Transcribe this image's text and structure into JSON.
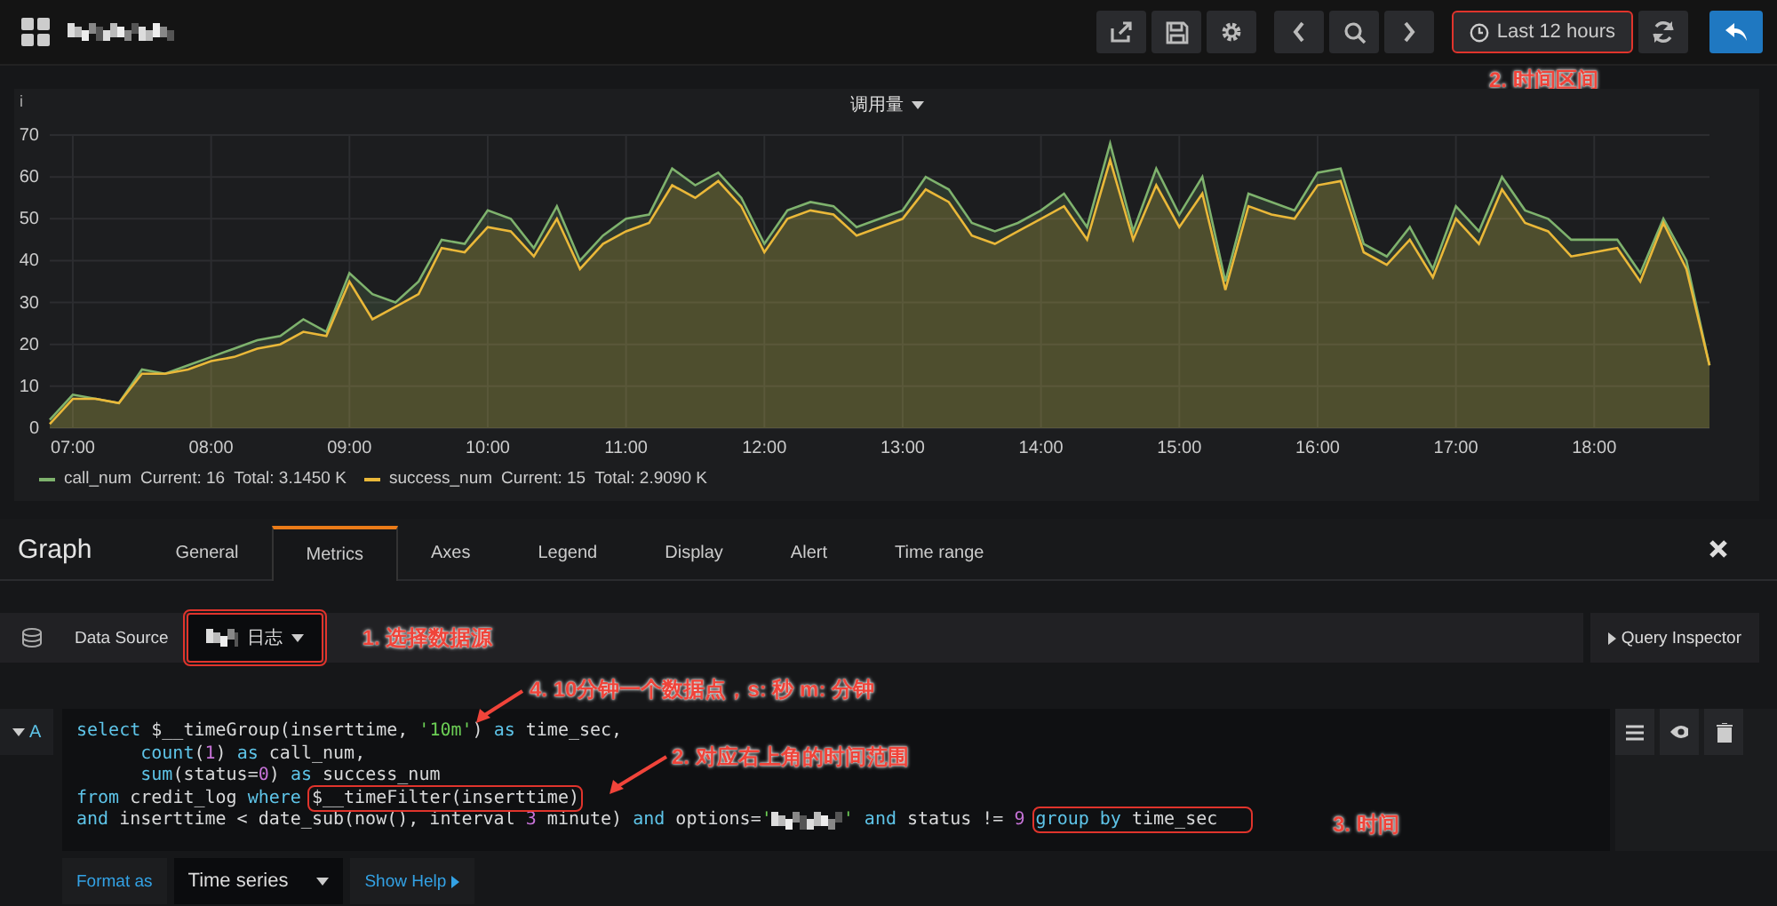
{
  "top_bar": {
    "time_picker": {
      "label": "Last 12 hours",
      "highlighted": true
    },
    "annotation": "2. 时间区间"
  },
  "panel": {
    "title": "调用量",
    "info": "i",
    "chart_data": {
      "type": "area",
      "grid": true,
      "ylim": [
        0,
        70
      ],
      "xlim": [
        410,
        1130
      ],
      "yticks": [
        0,
        10,
        20,
        30,
        40,
        50,
        60,
        70
      ],
      "xticks": [
        {
          "value": 420,
          "label": "07:00"
        },
        {
          "value": 480,
          "label": "08:00"
        },
        {
          "value": 540,
          "label": "09:00"
        },
        {
          "value": 600,
          "label": "10:00"
        },
        {
          "value": 660,
          "label": "11:00"
        },
        {
          "value": 720,
          "label": "12:00"
        },
        {
          "value": 780,
          "label": "13:00"
        },
        {
          "value": 840,
          "label": "14:00"
        },
        {
          "value": 900,
          "label": "15:00"
        },
        {
          "value": 960,
          "label": "16:00"
        },
        {
          "value": 1020,
          "label": "17:00"
        },
        {
          "value": 1080,
          "label": "18:00"
        }
      ],
      "x": [
        410,
        420,
        430,
        440,
        450,
        460,
        470,
        480,
        490,
        500,
        510,
        520,
        530,
        540,
        550,
        560,
        570,
        580,
        590,
        600,
        610,
        620,
        630,
        640,
        650,
        660,
        670,
        680,
        690,
        700,
        710,
        720,
        730,
        740,
        750,
        760,
        770,
        780,
        790,
        800,
        810,
        820,
        830,
        840,
        850,
        860,
        870,
        880,
        890,
        900,
        910,
        920,
        930,
        940,
        950,
        960,
        970,
        980,
        990,
        1000,
        1010,
        1020,
        1030,
        1040,
        1050,
        1060,
        1070,
        1080,
        1090,
        1100,
        1110,
        1120,
        1130
      ],
      "series": [
        {
          "name": "call_num",
          "color": "#7eb26d",
          "values": [
            2,
            8,
            7,
            6,
            14,
            13,
            15,
            17,
            19,
            21,
            22,
            26,
            23,
            37,
            32,
            30,
            35,
            45,
            44,
            52,
            50,
            43,
            53,
            40,
            46,
            50,
            51,
            62,
            58,
            61,
            55,
            44,
            52,
            54,
            53,
            48,
            50,
            52,
            60,
            57,
            49,
            47,
            49,
            52,
            56,
            48,
            68,
            47,
            62,
            51,
            60,
            35,
            56,
            54,
            52,
            61,
            62,
            44,
            41,
            48,
            38,
            53,
            47,
            60,
            52,
            50,
            45,
            45,
            45,
            37,
            50,
            40,
            15
          ]
        },
        {
          "name": "success_num",
          "color": "#eab839",
          "values": [
            1,
            7,
            7,
            6,
            13,
            13,
            14,
            16,
            17,
            19,
            20,
            23,
            22,
            35,
            26,
            29,
            32,
            43,
            42,
            48,
            47,
            41,
            50,
            38,
            44,
            47,
            49,
            58,
            55,
            59,
            53,
            42,
            50,
            52,
            51,
            46,
            48,
            50,
            57,
            54,
            46,
            44,
            47,
            50,
            53,
            45,
            64,
            45,
            58,
            48,
            56,
            33,
            53,
            51,
            50,
            58,
            59,
            42,
            39,
            45,
            36,
            50,
            44,
            57,
            49,
            47,
            41,
            42,
            43,
            35,
            49,
            38,
            15
          ]
        }
      ]
    },
    "legend": [
      {
        "current": "Current: 16",
        "total": "Total: 3.1450 K"
      },
      {
        "current": "Current: 15",
        "total": "Total: 2.9090 K"
      }
    ]
  },
  "editor": {
    "title": "Graph",
    "tabs": [
      {
        "label": "General",
        "selected": false
      },
      {
        "label": "Metrics",
        "selected": true
      },
      {
        "label": "Axes",
        "selected": false
      },
      {
        "label": "Legend",
        "selected": false
      },
      {
        "label": "Display",
        "selected": false
      },
      {
        "label": "Alert",
        "selected": false
      },
      {
        "label": "Time range",
        "selected": false
      }
    ],
    "data_source": {
      "label": "Data Source",
      "value": "日志",
      "highlighted": true,
      "annotation": "1. 选择数据源"
    },
    "query_inspector": "Query Inspector",
    "query": {
      "ref": "A",
      "lines": [
        [
          {
            "kind": "keyword",
            "text": "select"
          },
          {
            "kind": "plain",
            "text": " $__timeGroup(inserttime, "
          },
          {
            "kind": "string",
            "text": "'10m'"
          },
          {
            "kind": "plain",
            "text": ") "
          },
          {
            "kind": "keyword",
            "text": "as"
          },
          {
            "kind": "plain",
            "text": " time_sec,"
          }
        ],
        [
          {
            "kind": "keyword",
            "text": "      count"
          },
          {
            "kind": "plain",
            "text": "("
          },
          {
            "kind": "number",
            "text": "1"
          },
          {
            "kind": "plain",
            "text": ") "
          },
          {
            "kind": "keyword",
            "text": "as"
          },
          {
            "kind": "plain",
            "text": " call_num,"
          }
        ],
        [
          {
            "kind": "keyword",
            "text": "      sum"
          },
          {
            "kind": "plain",
            "text": "(status="
          },
          {
            "kind": "number",
            "text": "0"
          },
          {
            "kind": "plain",
            "text": ") "
          },
          {
            "kind": "keyword",
            "text": "as"
          },
          {
            "kind": "plain",
            "text": " success_num"
          }
        ],
        [
          {
            "kind": "keyword",
            "text": "from"
          },
          {
            "kind": "plain",
            "text": " credit_log "
          },
          {
            "kind": "keyword",
            "text": "where "
          },
          {
            "kind": "plain",
            "text": "$__timeFilter(inserttime)",
            "highlighted": true
          }
        ],
        [
          {
            "kind": "keyword",
            "text": "and"
          },
          {
            "kind": "plain",
            "text": " inserttime < date_sub(now(), interval "
          },
          {
            "kind": "number",
            "text": "3"
          },
          {
            "kind": "plain",
            "text": " minute) "
          },
          {
            "kind": "keyword",
            "text": "and"
          },
          {
            "kind": "plain",
            "text": " options="
          },
          {
            "kind": "string",
            "text": "'"
          },
          {
            "kind": "redacted"
          },
          {
            "kind": "string",
            "text": "'"
          },
          {
            "kind": "keyword",
            "text": " and"
          },
          {
            "kind": "plain",
            "text": " status != "
          },
          {
            "kind": "number",
            "text": "9 "
          },
          {
            "kind": "group",
            "highlighted": true,
            "children": [
              {
                "kind": "keyword",
                "text": "group by"
              },
              {
                "kind": "plain",
                "text": " time_sec   "
              }
            ]
          }
        ]
      ],
      "annotations": [
        {
          "text": "4. 10分钟一个数据点，s: 秒 m: 分钟",
          "arrow": true
        },
        {
          "text": "2. 对应右上角的时间范围",
          "arrow": true
        },
        {
          "text": "3. 时间",
          "arrow": false
        }
      ]
    },
    "format_label": "Format as",
    "format_value": "Time series",
    "show_help": "Show Help"
  }
}
